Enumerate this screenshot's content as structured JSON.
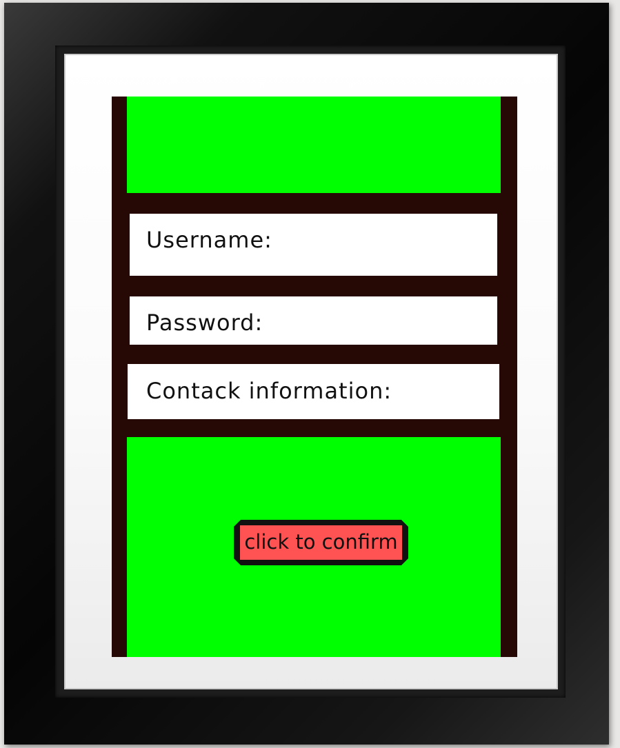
{
  "form": {
    "username_label": "Username:",
    "password_label": "Password:",
    "contact_label": "Contack information:",
    "confirm_label": "click to confirm"
  },
  "colors": {
    "panel_green": "#00ff00",
    "panel_background": "#260805",
    "button_red": "#ff5252",
    "field_white": "#ffffff",
    "frame_black": "#0a0a0a"
  }
}
